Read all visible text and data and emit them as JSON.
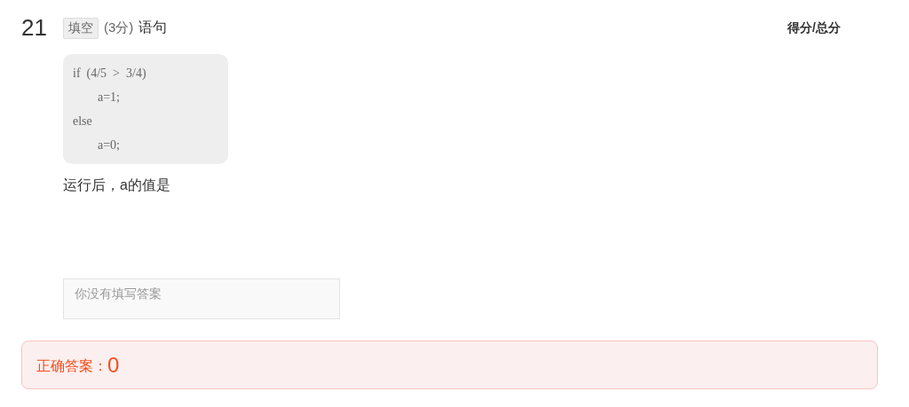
{
  "question": {
    "number": "21",
    "type_tag": "填空",
    "points": "(3分)",
    "title": "语句",
    "code_lines": [
      "if  (4/5  >  3/4)",
      "        a=1;",
      "else",
      "        a=0;"
    ],
    "prompt": "运行后，a的值是"
  },
  "score_label": "得分/总分",
  "answer_field": {
    "placeholder": "你没有填写答案"
  },
  "correct_answer": {
    "label": "正确答案：",
    "value": "0"
  }
}
